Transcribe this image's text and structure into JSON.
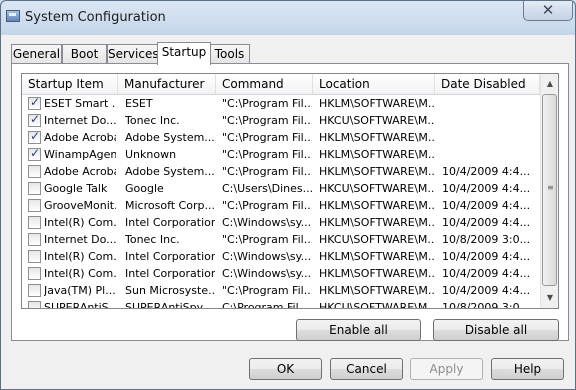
{
  "window": {
    "title": "System Configuration",
    "close_glyph": "✕"
  },
  "tabs": [
    "General",
    "Boot",
    "Services",
    "Startup",
    "Tools"
  ],
  "active_tab": "Startup",
  "columns": [
    "Startup Item",
    "Manufacturer",
    "Command",
    "Location",
    "Date Disabled"
  ],
  "rows": [
    {
      "checked": true,
      "item": "ESET Smart ...",
      "manufacturer": "ESET",
      "command": "\"C:\\Program Fil...",
      "location": "HKLM\\SOFTWARE\\M...",
      "date": ""
    },
    {
      "checked": true,
      "item": "Internet Do...",
      "manufacturer": "Tonec Inc.",
      "command": "\"C:\\Program Fil...",
      "location": "HKCU\\SOFTWARE\\M...",
      "date": ""
    },
    {
      "checked": true,
      "item": "Adobe Acrobat",
      "manufacturer": "Adobe System...",
      "command": "\"C:\\Program Fil...",
      "location": "HKLM\\SOFTWARE\\M...",
      "date": ""
    },
    {
      "checked": true,
      "item": "WinampAgent",
      "manufacturer": "Unknown",
      "command": "\"C:\\Program Fil...",
      "location": "HKLM\\SOFTWARE\\M...",
      "date": ""
    },
    {
      "checked": false,
      "item": "Adobe Acrobat",
      "manufacturer": "Adobe System...",
      "command": "\"C:\\Program Fil...",
      "location": "HKLM\\SOFTWARE\\M...",
      "date": "10/4/2009 4:4..."
    },
    {
      "checked": false,
      "item": "Google Talk",
      "manufacturer": "Google",
      "command": "C:\\Users\\Dines...",
      "location": "HKCU\\SOFTWARE\\M...",
      "date": "10/4/2009 4:4..."
    },
    {
      "checked": false,
      "item": "GrooveMonit...",
      "manufacturer": "Microsoft Corp...",
      "command": "\"C:\\Program Fil...",
      "location": "HKLM\\SOFTWARE\\M...",
      "date": "10/4/2009 4:4..."
    },
    {
      "checked": false,
      "item": "Intel(R) Com...",
      "manufacturer": "Intel Corporation",
      "command": "C:\\Windows\\sy...",
      "location": "HKLM\\SOFTWARE\\M...",
      "date": "10/4/2009 4:4..."
    },
    {
      "checked": false,
      "item": "Internet Do...",
      "manufacturer": "Tonec Inc.",
      "command": "\"C:\\Program Fil...",
      "location": "HKCU\\SOFTWARE\\M...",
      "date": "10/8/2009 3:0..."
    },
    {
      "checked": false,
      "item": "Intel(R) Com...",
      "manufacturer": "Intel Corporation",
      "command": "C:\\Windows\\sy...",
      "location": "HKLM\\SOFTWARE\\M...",
      "date": "10/4/2009 4:4..."
    },
    {
      "checked": false,
      "item": "Intel(R) Com...",
      "manufacturer": "Intel Corporation",
      "command": "C:\\Windows\\sy...",
      "location": "HKLM\\SOFTWARE\\M...",
      "date": "10/4/2009 4:4..."
    },
    {
      "checked": false,
      "item": "Java(TM) Pl...",
      "manufacturer": "Sun Microsyste...",
      "command": "\"C:\\Program Fil...",
      "location": "HKLM\\SOFTWARE\\M...",
      "date": "10/4/2009 4:4..."
    },
    {
      "checked": false,
      "item": "SUPERAntiS...",
      "manufacturer": "SUPERAntiSpy...",
      "command": "C:\\Program Fil...",
      "location": "HKCU\\SOFTWARE\\M...",
      "date": "10/8/2009 3:0..."
    }
  ],
  "buttons": {
    "enable_all": "Enable all",
    "disable_all": "Disable all",
    "ok": "OK",
    "cancel": "Cancel",
    "apply": "Apply",
    "help": "Help"
  },
  "scroll_glyphs": {
    "up": "▲",
    "down": "▼",
    "grip": "≡"
  }
}
